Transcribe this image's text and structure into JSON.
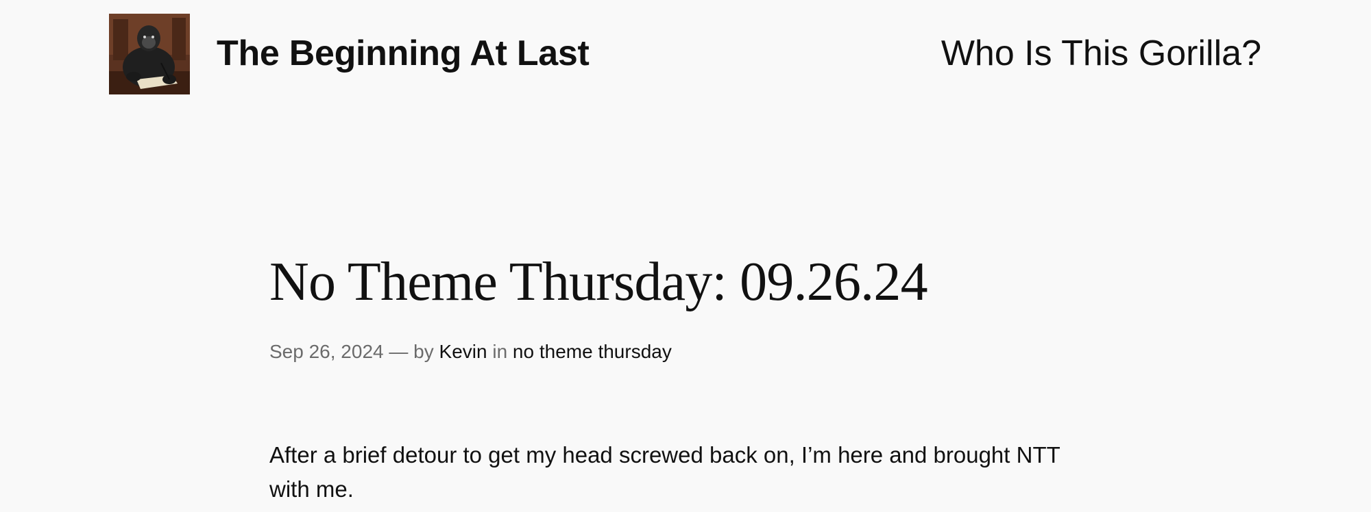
{
  "header": {
    "logo_alt": "Gorilla writing at a desk",
    "site_title": "The Beginning At Last",
    "nav": [
      {
        "label": "Who Is This Gorilla?"
      }
    ]
  },
  "post": {
    "title": "No Theme Thursday: 09.26.24",
    "meta": {
      "date": "Sep 26, 2024",
      "separator": "—",
      "by_label": "by",
      "author": "Kevin",
      "in_label": "in",
      "category": "no theme thursday"
    },
    "paragraphs": [
      "After a brief detour to get my head screwed back on, I’m here and brought NTT with me."
    ]
  },
  "colors": {
    "background": "#f9f9f9",
    "text": "#111111",
    "muted": "#6b6b6b"
  }
}
